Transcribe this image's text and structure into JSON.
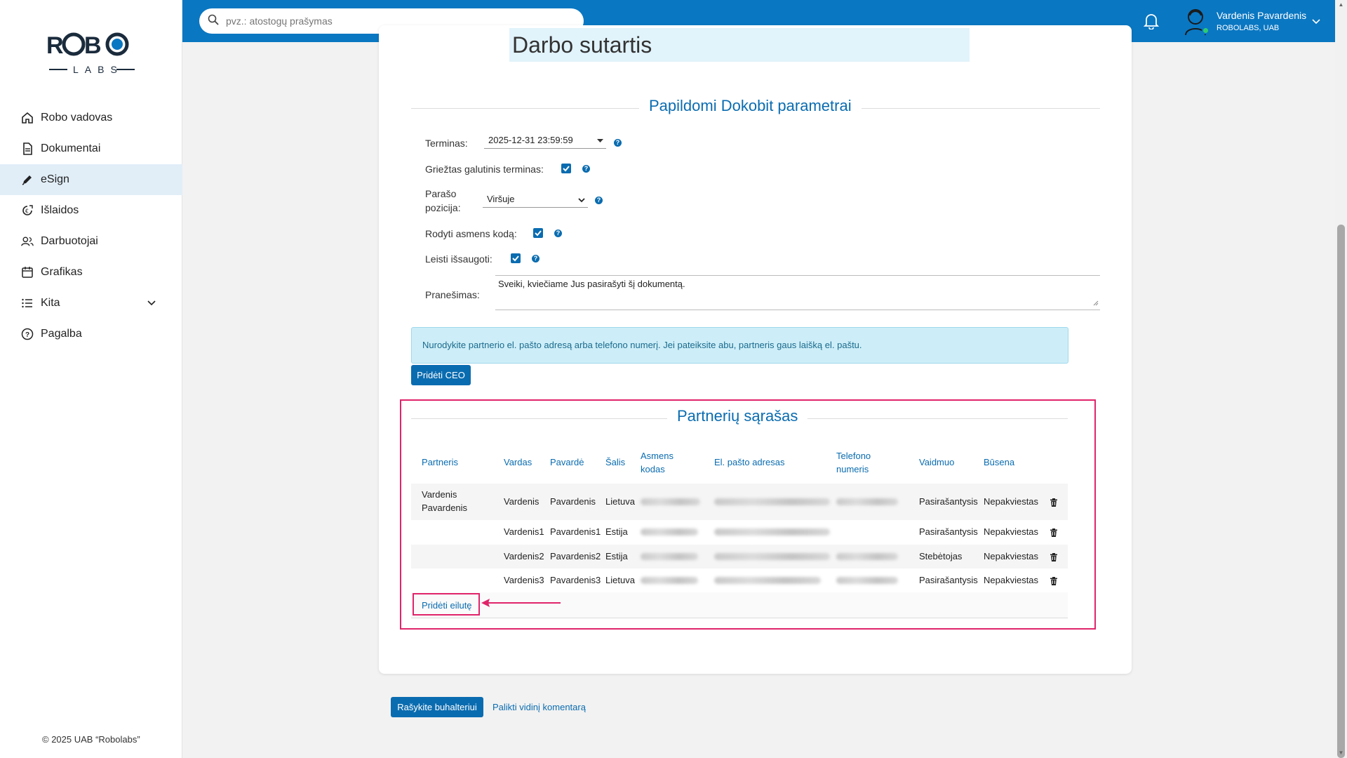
{
  "sidebar": {
    "logo_top": "ROBO",
    "logo_bottom": "LABS",
    "items": [
      {
        "label": "Robo vadovas",
        "icon": "home-icon"
      },
      {
        "label": "Dokumentai",
        "icon": "document-icon"
      },
      {
        "label": "eSign",
        "icon": "pen-icon",
        "active": true
      },
      {
        "label": "Išlaidos",
        "icon": "expenses-icon"
      },
      {
        "label": "Darbuotojai",
        "icon": "users-icon"
      },
      {
        "label": "Grafikas",
        "icon": "calendar-icon"
      },
      {
        "label": "Kita",
        "icon": "list-icon"
      },
      {
        "label": "Pagalba",
        "icon": "help-icon"
      }
    ],
    "copyright": "© 2025 UAB “Robolabs”"
  },
  "header": {
    "search_placeholder": "pvz.: atostogų prašymas",
    "user_name": "Vardenis Pavardenis",
    "user_company": "ROBOLABS, UAB"
  },
  "document": {
    "title": "Darbo sutartis"
  },
  "dokobit": {
    "section_title": "Papildomi Dokobit parametrai",
    "deadline_label": "Terminas:",
    "deadline_value": "2025-12-31 23:59:59",
    "strict_label": "Griežtas galutinis terminas:",
    "strict_checked": true,
    "position_label_1": "Parašo",
    "position_label_2": "pozicija:",
    "position_value": "Viršuje",
    "show_code_label": "Rodyti asmens kodą:",
    "show_code_checked": true,
    "allow_save_label": "Leisti išsaugoti:",
    "allow_save_checked": true,
    "message_label": "Pranešimas:",
    "message_value": "Sveiki, kviečiame Jus pasirašyti šį dokumentą.",
    "info_text": "Nurodykite partnerio el. pašto adresą arba telefono numerį. Jei pateiksite abu, partneris gaus laišką el. paštu.",
    "add_ceo_label": "Pridėti CEO"
  },
  "partners": {
    "section_title": "Partnerių sąrašas",
    "columns": {
      "partner": "Partneris",
      "first_name": "Vardas",
      "last_name": "Pavardė",
      "country": "Šalis",
      "personal_code_1": "Asmens",
      "personal_code_2": "kodas",
      "email": "El. pašto adresas",
      "phone_1": "Telefono",
      "phone_2": "numeris",
      "role": "Vaidmuo",
      "status": "Būsena"
    },
    "rows": [
      {
        "partner_1": "Vardenis",
        "partner_2": "Pavardenis",
        "first_name": "Vardenis",
        "last_name": "Pavardenis",
        "country": "Lietuva",
        "role": "Pasirašantysis",
        "status": "Nepakviestas"
      },
      {
        "partner_1": "",
        "partner_2": "",
        "first_name": "Vardenis1",
        "last_name": "Pavardenis1",
        "country": "Estija",
        "role": "Pasirašantysis",
        "status": "Nepakviestas"
      },
      {
        "partner_1": "",
        "partner_2": "",
        "first_name": "Vardenis2",
        "last_name": "Pavardenis2",
        "country": "Estija",
        "role": "Stebėtojas",
        "status": "Nepakviestas"
      },
      {
        "partner_1": "",
        "partner_2": "",
        "first_name": "Vardenis3",
        "last_name": "Pavardenis3",
        "country": "Lietuva",
        "role": "Pasirašantysis",
        "status": "Nepakviestas"
      }
    ],
    "add_row_label": "Pridėti eilutę"
  },
  "footer": {
    "write_accountant_label": "Rašykite buhalteriui",
    "internal_comment_label": "Palikti vidinį komentarą"
  },
  "colors": {
    "brand_blue": "#0a77c2",
    "link_blue": "#0a6cb0",
    "highlight": "#e0246a"
  }
}
